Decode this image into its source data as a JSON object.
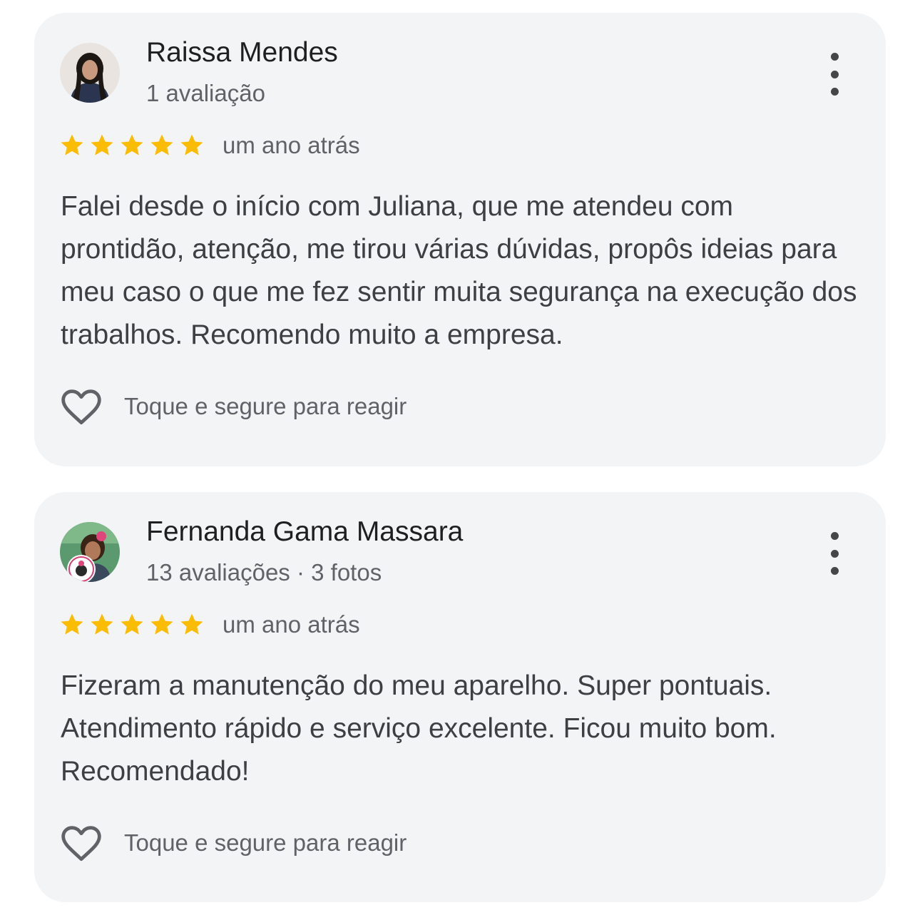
{
  "reviews": [
    {
      "author": "Raissa Mendes",
      "meta": "1 avaliação",
      "rating": 5,
      "time": "um ano atrás",
      "text": "Falei desde o início com Juliana, que me atendeu com prontidão, atenção, me tirou várias dúvidas, propôs ideias para meu caso o que me fez sentir muita segurança na execução dos trabalhos. Recomendo muito a empresa.",
      "react_label": "Toque e segure para reagir"
    },
    {
      "author": "Fernanda Gama Massara",
      "meta": "13 avaliações · 3 fotos",
      "rating": 5,
      "time": "um ano atrás",
      "text": "Fizeram a manutenção do meu aparelho. Super pontuais. Atendimento rápido e serviço excelente. Ficou muito bom. Recomendado!",
      "react_label": "Toque e segure para reagir"
    }
  ],
  "colors": {
    "card_bg": "#f3f4f6",
    "star": "#fbbc04",
    "text_primary": "#1f1f1f",
    "text_secondary": "#5f6368"
  },
  "icons": {
    "star": "star-icon",
    "more": "more-vert-icon",
    "react": "heart-outline-icon"
  }
}
